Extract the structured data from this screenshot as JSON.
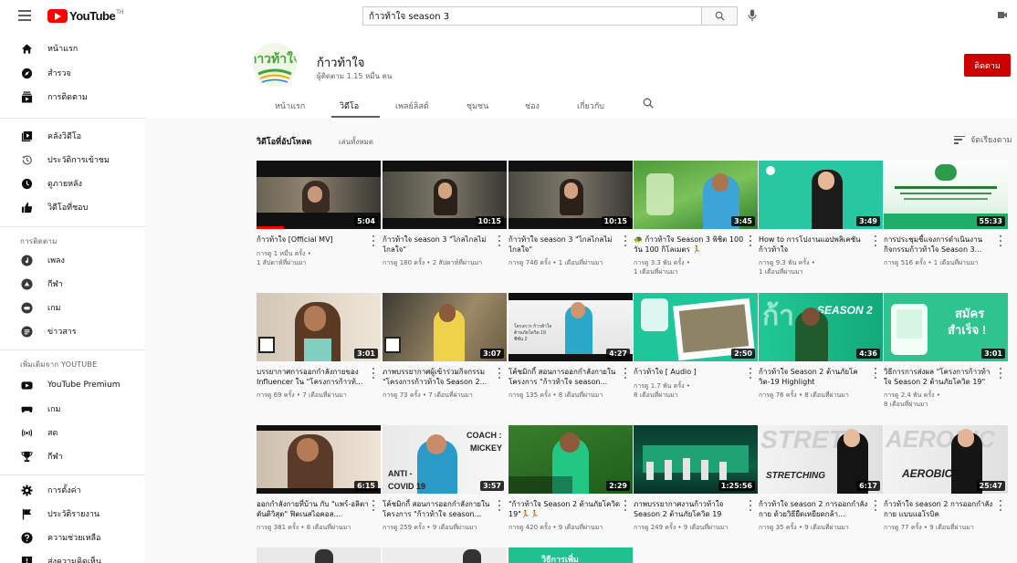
{
  "app": {
    "logo_text": "YouTube",
    "logo_sup": "TH",
    "search_value": "ก้าวท้าใจ season 3",
    "colors": {
      "brand": "#ff0000",
      "subscribe": "#cc0000"
    }
  },
  "sidebar": {
    "main": [
      {
        "label": "หน้าแรก",
        "icon": "home-icon"
      },
      {
        "label": "สำรวจ",
        "icon": "compass-icon"
      },
      {
        "label": "การติดตาม",
        "icon": "subscriptions-icon"
      }
    ],
    "library": [
      {
        "label": "คลังวิดีโอ",
        "icon": "library-icon"
      },
      {
        "label": "ประวัติการเข้าชม",
        "icon": "history-icon"
      },
      {
        "label": "ดูภายหลัง",
        "icon": "clock-icon"
      },
      {
        "label": "วิดีโอที่ชอบ",
        "icon": "thumbs-up-icon"
      }
    ],
    "subs_heading": "การติดตาม",
    "subs": [
      {
        "label": "เพลง",
        "icon": "music-icon"
      },
      {
        "label": "กีฬา",
        "icon": "sports-icon"
      },
      {
        "label": "เกม",
        "icon": "gaming-icon"
      },
      {
        "label": "ข่าวสาร",
        "icon": "news-icon"
      }
    ],
    "more_heading": "เพิ่มเติมจาก YOUTUBE",
    "more": [
      {
        "label": "YouTube Premium",
        "icon": "youtube-icon"
      },
      {
        "label": "เกม",
        "icon": "gamepad-icon"
      },
      {
        "label": "สด",
        "icon": "live-icon"
      },
      {
        "label": "กีฬา",
        "icon": "trophy-icon"
      }
    ],
    "settings": [
      {
        "label": "การตั้งค่า",
        "icon": "gear-icon"
      },
      {
        "label": "ประวัติรายงาน",
        "icon": "flag-icon"
      },
      {
        "label": "ความช่วยเหลือ",
        "icon": "help-icon"
      },
      {
        "label": "ส่งความคิดเห็น",
        "icon": "feedback-icon"
      }
    ]
  },
  "channel": {
    "name": "ก้าวท้าใจ",
    "subscribers": "ผู้ติดตาม 1.15 หมื่น คน",
    "subscribe_label": "ติดตาม",
    "avatar_text": "ก้าวท้าใจ",
    "tabs": [
      "หน้าแรก",
      "วิดีโอ",
      "เพลย์ลิสต์",
      "ชุมชน",
      "ช่อง",
      "เกี่ยวกับ"
    ],
    "active_tab": "วิดีโอ"
  },
  "section": {
    "title": "วิดีโอที่อัปโหลด",
    "play_all": "เล่นทั้งหมด",
    "sort_label": "จัดเรียงตาม"
  },
  "videos": [
    {
      "title": "ก้าวท้าใจ [Official MV]",
      "meta1": "การดู 1 หมื่น ครั้ง •",
      "meta2": "1 สัปดาห์ที่ผ่านมา",
      "duration": "5:04",
      "progress": 0.22
    },
    {
      "title": "ก้าวท้าใจ season 3 \"ไกลไกลไม่ไกลใจ\"",
      "meta1": "การดู 180 ครั้ง • 2 สัปดาห์ที่ผ่านมา",
      "meta2": "",
      "duration": "10:15"
    },
    {
      "title": "ก้าวท้าใจ season 3 \"ไกลไกลไม่ไกลใจ\"",
      "meta1": "การดู 746 ครั้ง • 1 เดือนที่ผ่านมา",
      "meta2": "",
      "duration": "10:15"
    },
    {
      "title": "🐢 ก้าวท้าใจ Season 3 พิชิต 100 วัน 100 กิโลเมตร 🏃",
      "meta1": "การดู 3.3 พัน ครั้ง •",
      "meta2": "1 เดือนที่ผ่านมา",
      "duration": "3:45"
    },
    {
      "title": "How to การโปงานแอปพลิเคชัน ก้าวท้าใจ",
      "meta1": "การดู 9.3 พัน ครั้ง •",
      "meta2": "1 เดือนที่ผ่านมา",
      "duration": "3:49"
    },
    {
      "title": "การประชุมชี้แจงการดำเนินงานกิจกรรมก้าวท้าใจ Season 3...",
      "meta1": "การดู 516 ครั้ง • 1 เดือนที่ผ่านมา",
      "meta2": "",
      "duration": "55:33"
    },
    {
      "title": "บรรยากาศการออกกำลังกายของ Influencer ใน \"โครงการก้าวท้...",
      "meta1": "การดู 69 ครั้ง • 7 เดือนที่ผ่านมา",
      "meta2": "",
      "duration": "3:01"
    },
    {
      "title": "ภาพบรรยากาศผู้เข้าร่วมกิจกรรม \"โครงการก้าวท้าใจ Season 2...",
      "meta1": "การดู 73 ครั้ง • 7 เดือนที่ผ่านมา",
      "meta2": "",
      "duration": "3:07"
    },
    {
      "title": "โค้ชมิกกี้ สอนการออกกำลังกายในโครงการ \"ก้าวท้าใจ season...",
      "meta1": "การดู 135 ครั้ง • 8 เดือนที่ผ่านมา",
      "meta2": "",
      "duration": "4:27"
    },
    {
      "title": "ก้าวท้าใจ [ Audio ]",
      "meta1": "การดู 1.7 พัน ครั้ง •",
      "meta2": "8 เดือนที่ผ่านมา",
      "duration": "2:50"
    },
    {
      "title": "ก้าวท้าใจ Season 2 ต้านภัยโควิด-19 Highlight",
      "meta1": "การดู 76 ครั้ง • 8 เดือนที่ผ่านมา",
      "meta2": "",
      "duration": "4:36"
    },
    {
      "title": "วิธีการการส่งผล \"โครงการก้าวท้าใจ Season 2 ต้านภัยโควิด 19\"",
      "meta1": "การดู 2.4 พัน ครั้ง •",
      "meta2": "8 เดือนที่ผ่านมา",
      "duration": "3:01"
    },
    {
      "title": "ออกกำลังกายที่บ้าน กับ \"แพร์-อลิตา ตันติวิสุต\" ฟิตเนสไอคอล...",
      "meta1": "การดู 381 ครั้ง • 8 เดือนที่ผ่านมา",
      "meta2": "",
      "duration": "6:15"
    },
    {
      "title": "โค้ชมิกกี้ สอนการออกกำลังกายในโครงการ \"ก้าวท้าใจ season...",
      "meta1": "การดู 259 ครั้ง • 9 เดือนที่ผ่านมา",
      "meta2": "",
      "duration": "3:57"
    },
    {
      "title": "\"ก้าวท้าใจ Season 2 ต้านภัยโควิด 19\"🏃🏃",
      "meta1": "การดู 420 ครั้ง • 9 เดือนที่ผ่านมา",
      "meta2": "",
      "duration": "2:29"
    },
    {
      "title": "ภาพบรรยากาศงานก้าวท้าใจ Season 2 ต้านภัยโควิด 19",
      "meta1": "การดู 249 ครั้ง • 9 เดือนที่ผ่านมา",
      "meta2": "",
      "duration": "1:25:56"
    },
    {
      "title": "ก้าวท้าใจ season 2 การออกกำลังกาย ด้วยวิธียืดเหยียดกล้า...",
      "meta1": "การดู 35 ครั้ง • 9 เดือนที่ผ่านมา",
      "meta2": "",
      "duration": "6:17"
    },
    {
      "title": "ก้าวท้าใจ season 2 การออกกำลังกาย แบบแอโรบิค",
      "meta1": "การดู 77 ครั้ง • 9 เดือนที่ผ่านมา",
      "meta2": "",
      "duration": "25:47"
    }
  ],
  "thumb_text": {
    "t9_line1": "โครงการ ก้าวท้าใจ",
    "t9_line2": "ต้านภัยโควิด 19",
    "t9_line3": "ซีซั่น 2",
    "t11": "SEASON 2",
    "t12_line1": "สมัคร",
    "t12_line2": "สำเร็จ !",
    "t14_coach": "COACH :",
    "t14_mickey": "MICKEY",
    "t14_anti": "ANTI -",
    "t14_covid": "COVID 19",
    "t17_big": "STRET",
    "t17_small": "STRETCHING",
    "t18_big": "AEROBIC",
    "t18_small": "AEROBIC",
    "r4_text": "วิธีการเพิ่ม"
  }
}
